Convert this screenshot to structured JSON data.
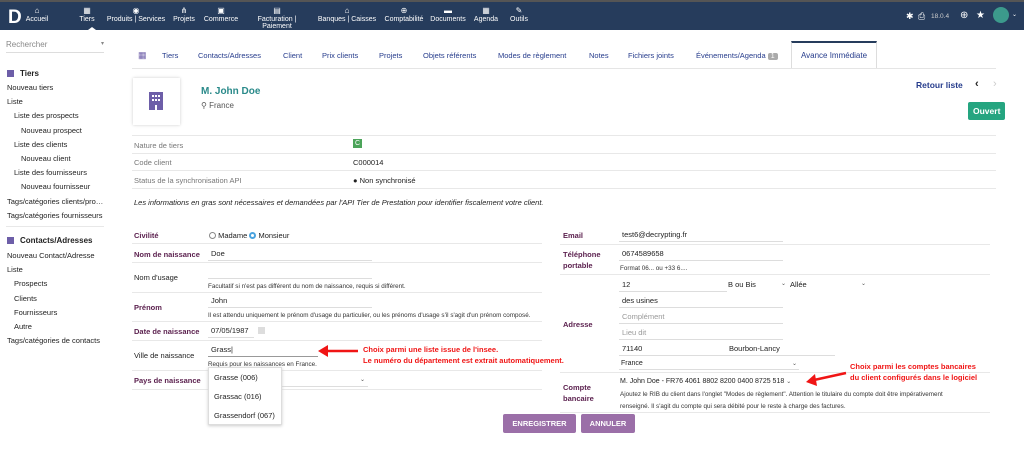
{
  "topbar": {
    "logo": "D",
    "menu": [
      {
        "label": "Accueil",
        "icon": "home-icon",
        "glyph": "⌂"
      },
      {
        "label": "Tiers",
        "icon": "building-icon",
        "glyph": "▦"
      },
      {
        "label": "Produits | Services",
        "icon": "cube-icon",
        "glyph": "◉"
      },
      {
        "label": "Projets",
        "icon": "sitemap-icon",
        "glyph": "⋔"
      },
      {
        "label": "Commerce",
        "icon": "suitcase-icon",
        "glyph": "▣"
      },
      {
        "label": "Facturation | Paiement",
        "icon": "invoice-icon",
        "glyph": "▤"
      },
      {
        "label": "Banques | Caisses",
        "icon": "bank-icon",
        "glyph": "⌂"
      },
      {
        "label": "Comptabilité",
        "icon": "search-dollar-icon",
        "glyph": "⊕"
      },
      {
        "label": "Documents",
        "icon": "folder-icon",
        "glyph": "▬"
      },
      {
        "label": "Agenda",
        "icon": "calendar-icon",
        "glyph": "▦"
      },
      {
        "label": "Outils",
        "icon": "wrench-icon",
        "glyph": "✎"
      }
    ],
    "version": "18.0.4"
  },
  "sidebar": {
    "search_placeholder": "Rechercher",
    "tiers": {
      "title": "Tiers",
      "items": [
        "Nouveau tiers",
        "Liste",
        "Liste des prospects",
        "Nouveau prospect",
        "Liste des clients",
        "Nouveau client",
        "Liste des fournisseurs",
        "Nouveau fournisseur",
        "Tags/catégories clients/prospects",
        "Tags/catégories fournisseurs"
      ]
    },
    "contacts": {
      "title": "Contacts/Adresses",
      "items": [
        "Nouveau Contact/Adresse",
        "Liste",
        "Prospects",
        "Clients",
        "Fournisseurs",
        "Autre",
        "Tags/catégories de contacts"
      ]
    }
  },
  "tabs": [
    "Tiers",
    "Contacts/Adresses",
    "Client",
    "Prix clients",
    "Projets",
    "Objets référents",
    "Modes de règlement",
    "Notes",
    "Fichiers joints",
    "Événements/Agenda",
    "Avance Immédiate"
  ],
  "events_badge": "1",
  "header": {
    "name": "M. John Doe",
    "country": "France",
    "back": "Retour liste",
    "status": "Ouvert"
  },
  "info": {
    "nature_label": "Nature de tiers",
    "nature_value": "C",
    "code_label": "Code client",
    "code_value": "C000014",
    "sync_label": "Status de la synchronisation API",
    "sync_value": "Non synchronisé"
  },
  "notice": "Les informations en gras sont nécessaires et demandées par l'API Tier de Prestation pour identifier fiscalement votre client.",
  "form": {
    "civilite_label": "Civilité",
    "madame": "Madame",
    "monsieur": "Monsieur",
    "nom_naissance_label": "Nom de naissance",
    "nom_naissance": "Doe",
    "nom_usage_label": "Nom d'usage",
    "nom_usage_help": "Facultatif si n'est pas différent du nom de naissance, requis si différent.",
    "prenom_label": "Prénom",
    "prenom": "John",
    "prenom_help": "Il est attendu uniquement le prénom d'usage du particulier, ou les prénoms d'usage s'il s'agit d'un prénom composé.",
    "date_label": "Date de naissance",
    "date": "07/05/1987",
    "ville_label": "Ville de naissance",
    "ville": "Grass",
    "ville_help": "Requis pour les naissances en France.",
    "ville_options": [
      "Grasse (006)",
      "Grassac (016)",
      "Grassendorf (067)"
    ],
    "pays_label": "Pays de naissance",
    "email_label": "Email",
    "email": "test6@decrypting.fr",
    "tel_label1": "Téléphone",
    "tel_label2": "portable",
    "tel": "0674589658",
    "tel_help": "Format 06... ou +33 6....",
    "adresse_label": "Adresse",
    "num": "12",
    "bis": "B ou Bis",
    "voie_type": "Allée",
    "voie": "des usines",
    "complement_ph": "Complément",
    "lieudit_ph": "Lieu dit",
    "cp": "71140",
    "ville_adr": "Bourbon-Lancy",
    "pays_adr": "France",
    "compte_label1": "Compte",
    "compte_label2": "bancaire",
    "compte": "M. John Doe - FR76 4061 8802 8200 0400 8725 518",
    "compte_help1": "Ajoutez le RIB du client dans l'onglet \"Modes de règlement\". Attention le titulaire du compte doit être impérativement",
    "compte_help2": "renseigné. Il s'agit du compte qui sera débité pour le reste à charge des factures.",
    "save": "ENREGISTRER",
    "cancel": "ANNULER"
  },
  "annotations": {
    "a1": "Choix parmi une liste issue de l'insee.",
    "a2": "Le numéro du département est extrait automatiquement.",
    "b1": "Choix parmi les comptes bancaires",
    "b2": "du client configurés dans le logiciel"
  },
  "colors": {
    "topbar": "#263c5c",
    "label": "#5a1f4d",
    "status": "#25a580",
    "button": "#9b6fa8",
    "annotation": "#f01515"
  }
}
